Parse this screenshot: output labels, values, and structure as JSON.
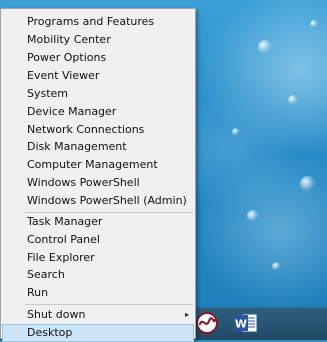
{
  "menu": {
    "group1": [
      "Programs and Features",
      "Mobility Center",
      "Power Options",
      "Event Viewer",
      "System",
      "Device Manager",
      "Network Connections",
      "Disk Management",
      "Computer Management",
      "Windows PowerShell",
      "Windows PowerShell (Admin)"
    ],
    "group2": [
      "Task Manager",
      "Control Panel",
      "File Explorer",
      "Search",
      "Run"
    ],
    "shutdown": {
      "label": "Shut down",
      "arrow": "▸"
    },
    "desktop": "Desktop"
  },
  "taskbar": {
    "icons": [
      "app-swirl-icon",
      "word-icon"
    ],
    "word_letter": "W"
  },
  "colors": {
    "menu_bg": "#f0f0f0",
    "selected_bg": "#cce4f7",
    "desktop_blue": "#2a8cc6",
    "taskbar": "#204a66",
    "word_blue": "#2b579a"
  }
}
